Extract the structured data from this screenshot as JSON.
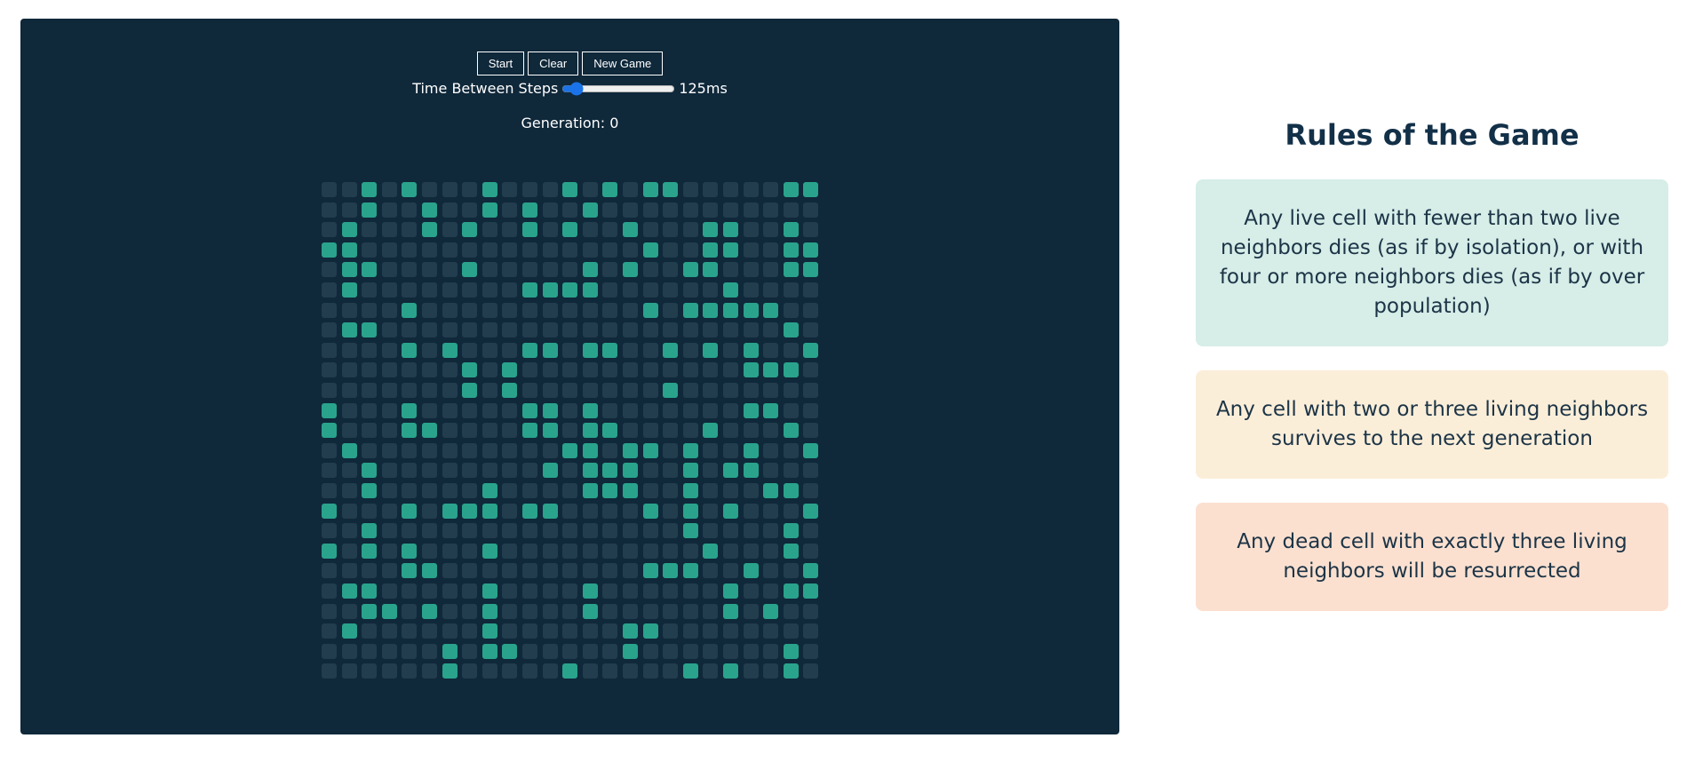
{
  "controls": {
    "start_label": "Start",
    "clear_label": "Clear",
    "new_game_label": "New Game",
    "speed_label": "Time Between Steps",
    "speed_value_ms": 125,
    "speed_min_ms": 50,
    "speed_max_ms": 1000,
    "speed_display": "125ms"
  },
  "generation": {
    "label": "Generation: 0",
    "value": 0
  },
  "grid": {
    "rows": 25,
    "cols": 25,
    "alive_color": "#2aa38c",
    "dead_color": "#223d4e",
    "cells": [
      "0010100010001010110000011",
      "0010010010100100000000000",
      "0100010100101001000110010",
      "1100000000000000100110011",
      "0110000100000101001100011",
      "0100000000111100000010000",
      "0000100000000000101111100",
      "0110000000000000000000010",
      "0000101000110110010101001",
      "0000000101000000000001110",
      "0000000101000000010000000",
      "1000100000110100000001100",
      "1000110000110110000100010",
      "0100000000001101101001001",
      "0010000000010111001011000",
      "0010000010000111001000110",
      "1000101110110000101010001",
      "0010000000000000001000010",
      "1010100010000000000100010",
      "0000110000000000111001001",
      "0110000010000100000010011",
      "0011010010000100000010100",
      "0100000010000001100000000",
      "0000001011000001000000010",
      "0000001000001000001010010"
    ]
  },
  "rules": {
    "title": "Rules of the Game",
    "items": [
      {
        "text": "Any live cell with fewer than two live neighbors dies (as if by isolation), or with four or more neighbors dies (as if by over population)",
        "color": "#d6ede8"
      },
      {
        "text": "Any cell with two or three living neighbors survives to the next generation",
        "color": "#fbeed9"
      },
      {
        "text": "Any dead cell with exactly three living neighbors will be resurrected",
        "color": "#fbe0d0"
      }
    ]
  },
  "colors": {
    "panel_background": "#0f283a",
    "accent": "#1a73e8"
  }
}
